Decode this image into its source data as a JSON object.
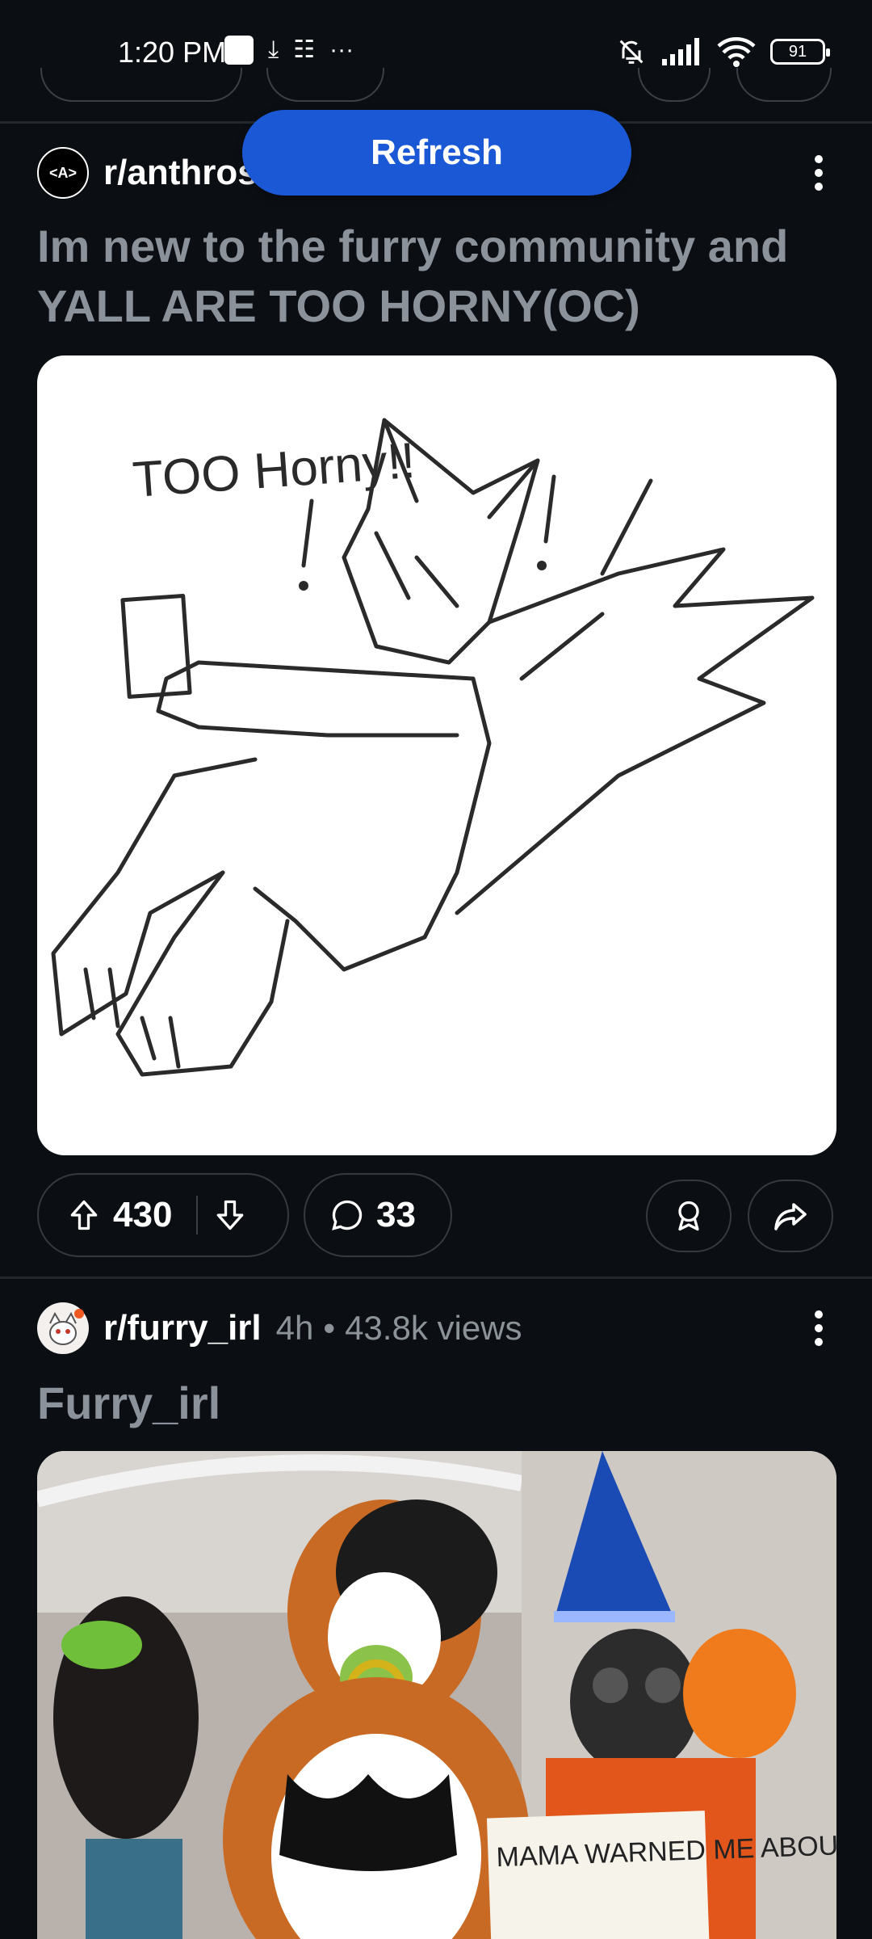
{
  "status_bar": {
    "time": "1:20 PM",
    "battery": "91"
  },
  "refresh_button": {
    "label": "Refresh"
  },
  "posts": [
    {
      "subreddit": "r/anthros",
      "avatar_text": "<A>",
      "title": "Im new to the furry community and YALL ARE TOO HORNY(OC)",
      "image_caption": "TOO Horny!!",
      "upvotes": "430",
      "comments": "33"
    },
    {
      "subreddit": "r/furry_irl",
      "time_ago": "4h",
      "separator": "•",
      "views": "43.8k views",
      "title": "Furry_irl",
      "sign_text": "MAMA WARNED ME ABOUT WOMEN"
    }
  ],
  "colors": {
    "background": "#0b0f14",
    "accent": "#1a58d6",
    "title": "#8b9299"
  }
}
